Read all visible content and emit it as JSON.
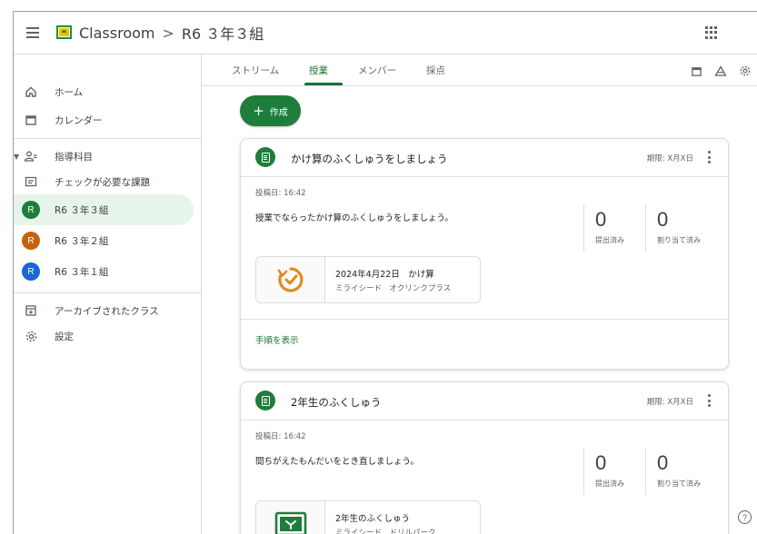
{
  "header": {
    "app_name": "Classroom",
    "separator": ">",
    "class_name": "R6 ３年３組"
  },
  "sidebar": {
    "home": "ホーム",
    "calendar": "カレンダー",
    "teaching": "指導科目",
    "review": "チェックが必要な課題",
    "classes": [
      {
        "initial": "R",
        "name": "R6 ３年３組",
        "color": "#1e7d3a"
      },
      {
        "initial": "R",
        "name": "R6 ３年２組",
        "color": "#c5620f"
      },
      {
        "initial": "R",
        "name": "R6 ３年１組",
        "color": "#1967d2"
      }
    ],
    "archived": "アーカイブされたクラス",
    "settings": "設定"
  },
  "tabs": [
    "ストリーム",
    "授業",
    "メンバー",
    "採点"
  ],
  "active_tab": "授業",
  "create_label": "作成",
  "assignments": [
    {
      "title": "かけ算のふくしゅうをしましょう",
      "due": "期限: X月X日",
      "posted": "投稿日: 16:42",
      "description": "授業でならったかけ算のふくしゅうをしましょう。",
      "submitted_count": "0",
      "submitted_label": "提出済み",
      "assigned_count": "0",
      "assigned_label": "割り当て済み",
      "attachment_title": "2024年4月22日　かけ算",
      "attachment_sub": "ミライシード　オクリンクプラス",
      "attachment_icon": "clock-arrow-icon",
      "footer_link": "手順を表示"
    },
    {
      "title": "2年生のふくしゅう",
      "due": "期限: X月X日",
      "posted": "投稿日: 16:42",
      "description": "間ちがえたもんだいをとき直しましょう。",
      "submitted_count": "0",
      "submitted_label": "提出済み",
      "assigned_count": "0",
      "assigned_label": "割り当て済み",
      "attachment_title": "2年生のふくしゅう",
      "attachment_sub": "ミライシード　ドリルパーク",
      "attachment_icon": "drill-park-icon"
    }
  ],
  "help": "?",
  "colors": {
    "accent": "#137333",
    "primary_button": "#1e7d3a",
    "active_nav_bg": "#e6f4ea",
    "orange": "#e08a1e"
  }
}
